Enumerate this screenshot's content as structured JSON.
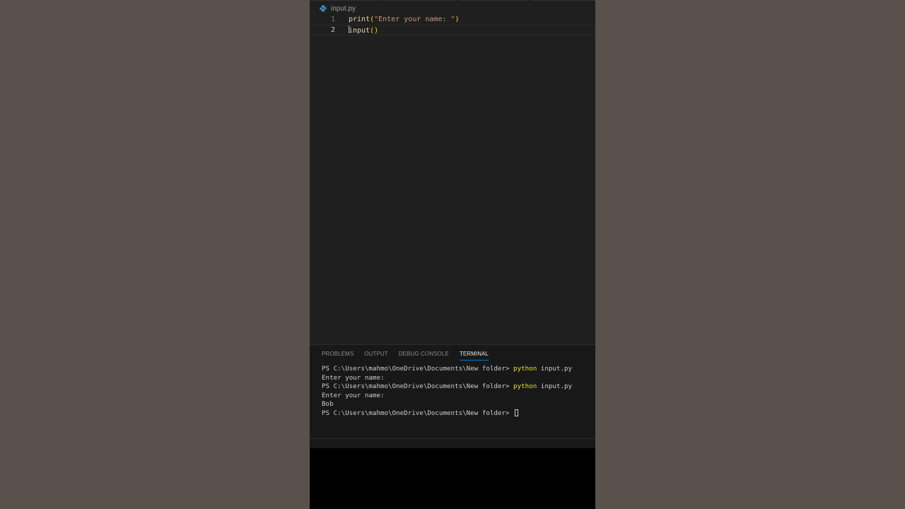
{
  "editor": {
    "file_tab": "input.py",
    "lines": [
      {
        "number": "1",
        "fn": "print",
        "open": "(",
        "string": "\"Enter your name: \"",
        "close": ")"
      },
      {
        "number": "2",
        "fn": "input",
        "open": "(",
        "close": ")"
      }
    ]
  },
  "panel": {
    "tabs": [
      {
        "label": "PROBLEMS"
      },
      {
        "label": "OUTPUT"
      },
      {
        "label": "DEBUG CONSOLE"
      },
      {
        "label": "TERMINAL",
        "active": true
      }
    ]
  },
  "terminal": {
    "lines": [
      {
        "prompt": "PS C:\\Users\\mahmo\\OneDrive\\Documents\\New folder> ",
        "cmd": "python",
        "args": " input.py"
      },
      {
        "text": "Enter your name:"
      },
      {
        "prompt": "PS C:\\Users\\mahmo\\OneDrive\\Documents\\New folder> ",
        "cmd": "python",
        "args": " input.py"
      },
      {
        "text": "Enter your name:"
      },
      {
        "text": "Bob"
      },
      {
        "prompt": "PS C:\\Users\\mahmo\\OneDrive\\Documents\\New folder> "
      }
    ]
  },
  "icons": {
    "file_icon": "python-icon"
  },
  "colors": {
    "background": "#5a514c",
    "editor_bg": "#1f1f1f",
    "panel_bg": "#181818",
    "function": "#dcdcaa",
    "bracket": "#ffd700",
    "string": "#ce9178",
    "command": "#e5e510",
    "active_tab_underline": "#0078d4"
  }
}
